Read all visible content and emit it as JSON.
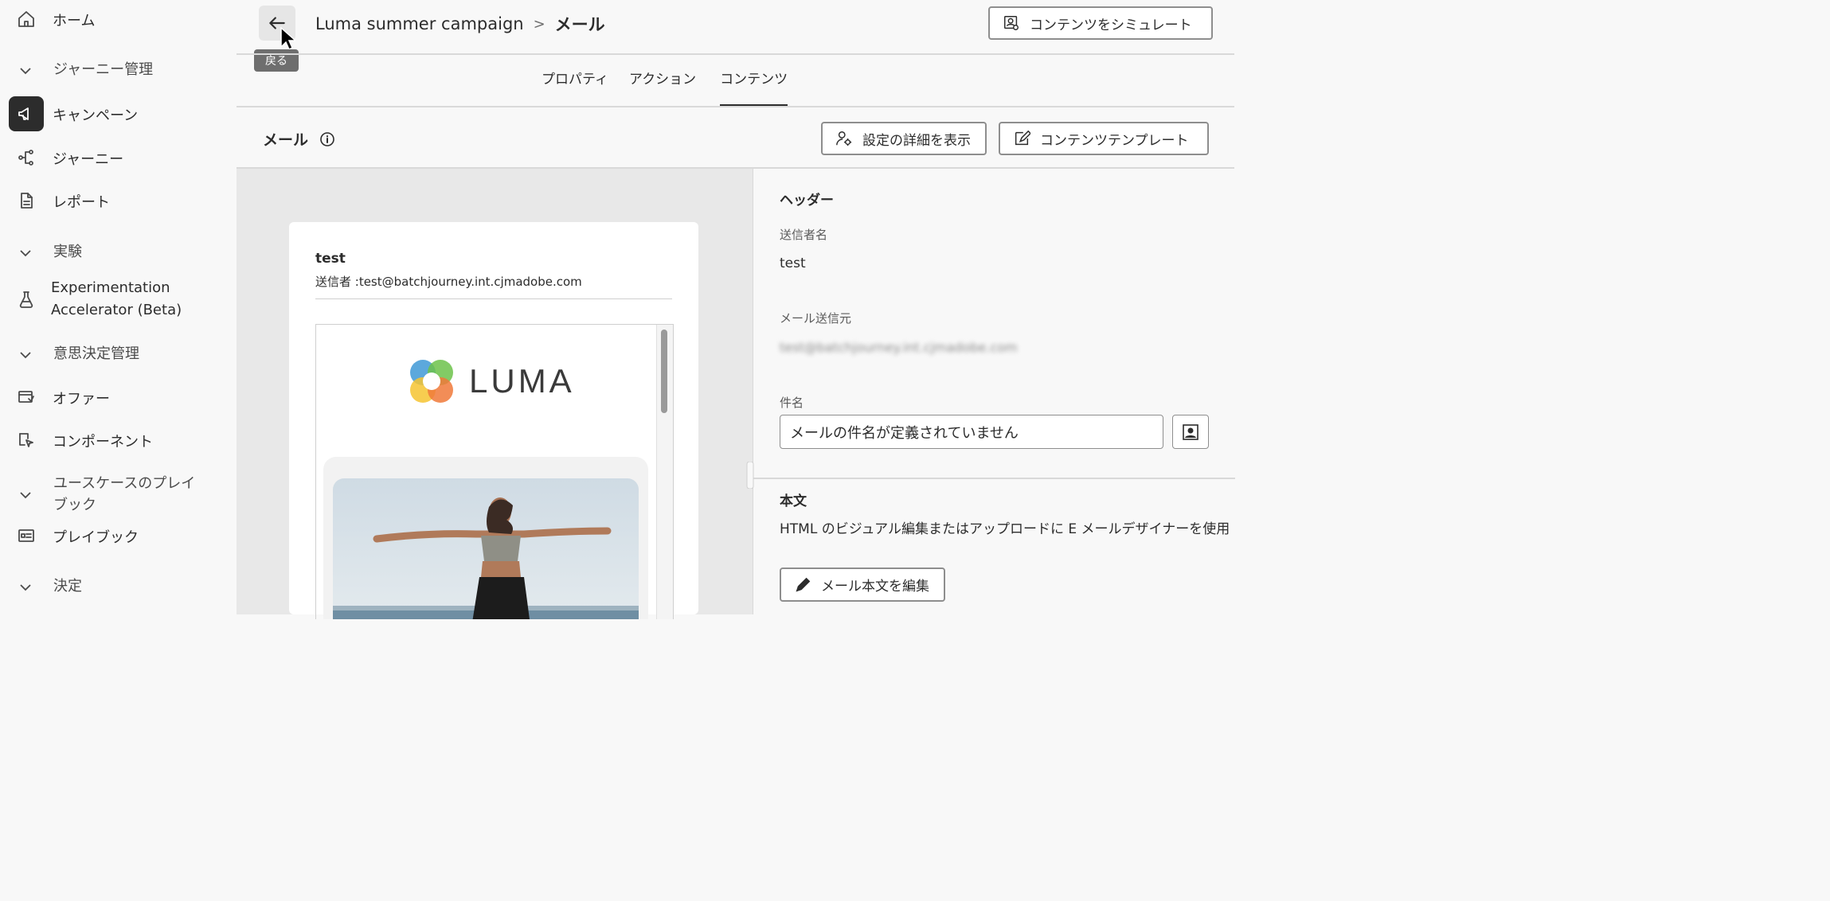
{
  "sidebar": {
    "items": [
      {
        "label": "ホーム",
        "icon": "home-icon"
      },
      {
        "label": "ジャーニー管理",
        "type": "section"
      },
      {
        "label": "キャンペーン",
        "icon": "megaphone-icon",
        "active": true
      },
      {
        "label": "ジャーニー",
        "icon": "journey-icon"
      },
      {
        "label": "レポート",
        "icon": "report-icon"
      },
      {
        "label": "実験",
        "type": "section"
      },
      {
        "label": "Experimentation Accelerator (Beta)",
        "line1": "Experimentation",
        "line2": "Accelerator (Beta)",
        "icon": "flask-icon"
      },
      {
        "label": "意思決定管理",
        "type": "section"
      },
      {
        "label": "オファー",
        "icon": "offer-icon"
      },
      {
        "label": "コンポーネント",
        "icon": "component-icon"
      },
      {
        "label": "ユースケースのプレイブック",
        "line1": "ユースケースのプレイ",
        "line2": "ブック",
        "type": "section"
      },
      {
        "label": "プレイブック",
        "icon": "playbook-icon"
      },
      {
        "label": "決定",
        "type": "section"
      }
    ]
  },
  "header": {
    "back_tooltip": "戻る",
    "breadcrumb_parent": "Luma summer campaign",
    "breadcrumb_sep": ">",
    "breadcrumb_current": "メール",
    "simulate_label": "コンテンツをシミュレート"
  },
  "tabs": [
    "プロパティ",
    "アクション",
    "コンテンツ"
  ],
  "active_tab": "コンテンツ",
  "toolbar": {
    "title": "メール",
    "settings_label": "設定の詳細を表示",
    "template_label": "コンテンツテンプレート"
  },
  "preview": {
    "sender_name": "test",
    "sender_line": "送信者 :test@batchjourney.int.cjmadobe.com",
    "logo_text": "LUMA"
  },
  "panel": {
    "header_heading": "ヘッダー",
    "sender_name_label": "送信者名",
    "sender_name_value": "test",
    "email_from_label": "メール送信元",
    "email_from_value": "test@batchjourney.int.cjmadobe.com",
    "subject_label": "件名",
    "subject_value": "メールの件名が定義されていません",
    "body_heading": "本文",
    "body_desc": "HTML のビジュアル編集またはアップロードに E メールデザイナーを使用",
    "edit_body_label": "メール本文を編集"
  },
  "colors": {
    "accent": "#2c2c2c",
    "preview_bg": "#e8e8e8"
  }
}
